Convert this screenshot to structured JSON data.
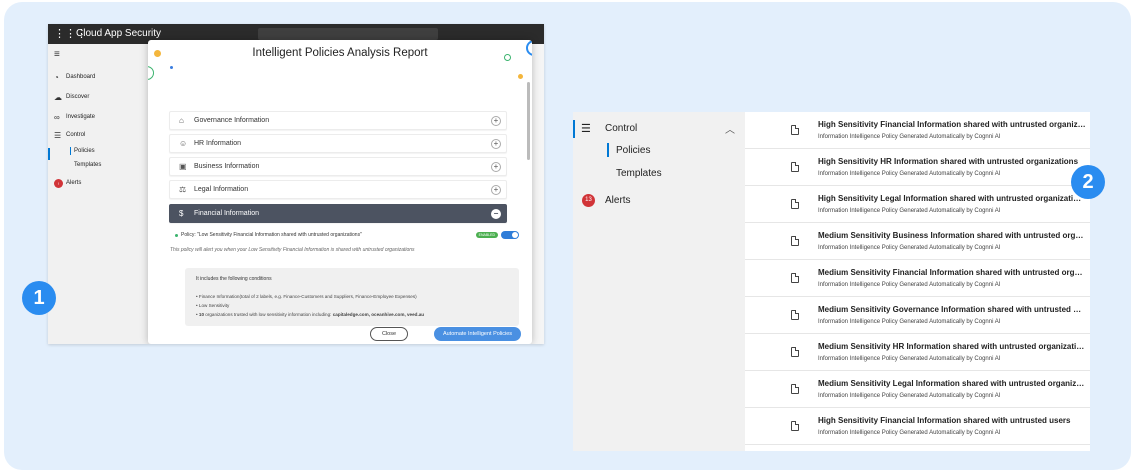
{
  "left_screenshot": {
    "app_title": "Cloud App Security",
    "sidebar": {
      "items": [
        {
          "label": "Dashboard",
          "icon": "gauge-icon"
        },
        {
          "label": "Discover",
          "icon": "cloud-icon"
        },
        {
          "label": "Investigate",
          "icon": "glasses-icon"
        },
        {
          "label": "Control",
          "icon": "sliders-icon"
        },
        {
          "label": "Policies",
          "icon": ""
        },
        {
          "label": "Templates",
          "icon": ""
        },
        {
          "label": "Alerts",
          "icon": "alert-icon"
        }
      ]
    },
    "modal": {
      "title": "Intelligent Policies Analysis Report",
      "categories": [
        {
          "label": "Governance Information",
          "icon": "bank-icon",
          "toggle": "+"
        },
        {
          "label": "HR Information",
          "icon": "people-icon",
          "toggle": "+"
        },
        {
          "label": "Business Information",
          "icon": "briefcase-icon",
          "toggle": "+"
        },
        {
          "label": "Legal Information",
          "icon": "scales-icon",
          "toggle": "+"
        },
        {
          "label": "Financial Information",
          "icon": "dollar-icon",
          "toggle": "−"
        }
      ],
      "policy_label": "Policy: \"Low Sensitivity Financial Information shared with untrusted organizations\"",
      "policy_status": "ENABLED",
      "policy_description": "This policy will alert you when your Low Sensitivity Financial Information is shared with untrusted organizations",
      "conditions_title": "It includes the following conditions",
      "conditions": [
        "Finance Information(total of 2 labels, e.g. Finance-Customers and Suppliers, Finance-Employee Expenses)",
        "Low Sensitivity"
      ],
      "conditions_last_bold": "10",
      "conditions_last_text": " organizations trusted with low sensitivity information including: ",
      "conditions_last_domains": "capitaledge.com, oceanhive.com, veed.au",
      "close_label": "Close",
      "automate_label": "Automate Intelligent Policies"
    }
  },
  "badges": {
    "one": "1",
    "two": "2"
  },
  "right_screenshot": {
    "sidebar": {
      "control_label": "Control",
      "policies_label": "Policies",
      "templates_label": "Templates",
      "alerts_label": "Alerts",
      "alerts_count": "13"
    },
    "subtitle": "Information Intelligence Policy Generated Automatically by Cognni AI",
    "rows": [
      "High Sensitivity Financial Information shared with untrusted organizations",
      "High Sensitivity HR Information shared with untrusted organizations",
      "High Sensitivity Legal Information shared with untrusted organizations",
      "Medium Sensitivity Business Information shared with untrusted organizations",
      "Medium Sensitivity Financial Information shared with untrusted organizations",
      "Medium Sensitivity Governance Information shared with untrusted organizations",
      "Medium Sensitivity HR Information shared with untrusted organizations",
      "Medium Sensitivity Legal Information shared with untrusted organizations",
      "High Sensitivity Financial Information shared with untrusted users"
    ]
  },
  "colors": {
    "accent": "#2a8cf0",
    "panel_bg": "#e3effc",
    "dark_row": "#4c5361",
    "enabled": "#4caf50"
  }
}
